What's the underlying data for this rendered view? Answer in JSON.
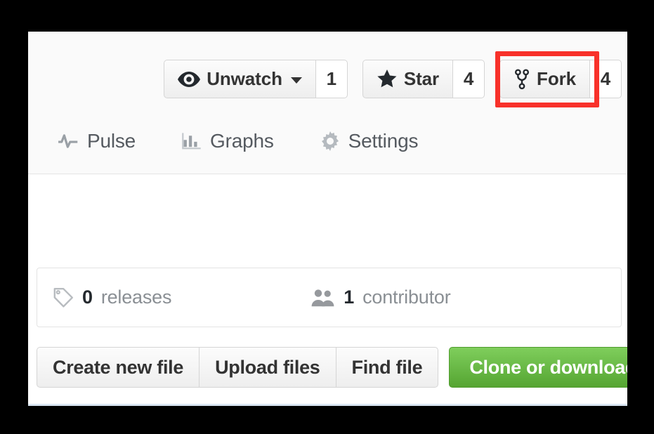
{
  "card": {
    "accent_green": "#55a532",
    "highlight_color": "#f8312a",
    "header_bg": "#fafafa",
    "body_bg": "#ffffff"
  },
  "pagehead_actions": [
    {
      "id": "watch",
      "icon": "eye-icon",
      "label": "Unwatch",
      "has_caret": true,
      "count": "1"
    },
    {
      "id": "star",
      "icon": "star-icon",
      "label": "Star",
      "has_caret": false,
      "count": "4"
    },
    {
      "id": "fork",
      "icon": "repo-forked-icon",
      "label": "Fork",
      "has_caret": false,
      "count": "4",
      "highlighted": true
    }
  ],
  "repo_nav": [
    {
      "id": "pulse",
      "icon": "pulse-icon",
      "label": "Pulse"
    },
    {
      "id": "graphs",
      "icon": "graph-icon",
      "label": "Graphs"
    },
    {
      "id": "settings",
      "icon": "gear-icon",
      "label": "Settings"
    }
  ],
  "numbers_summary": [
    {
      "id": "releases",
      "icon": "tag-icon",
      "num": "0",
      "label": "releases"
    },
    {
      "id": "contributors",
      "icon": "organization-icon",
      "num": "1",
      "label": "contributor"
    }
  ],
  "file_toolbar": {
    "create_new_file": "Create new file",
    "upload_files": "Upload files",
    "find_file": "Find file",
    "clone_or_download": "Clone or download"
  }
}
